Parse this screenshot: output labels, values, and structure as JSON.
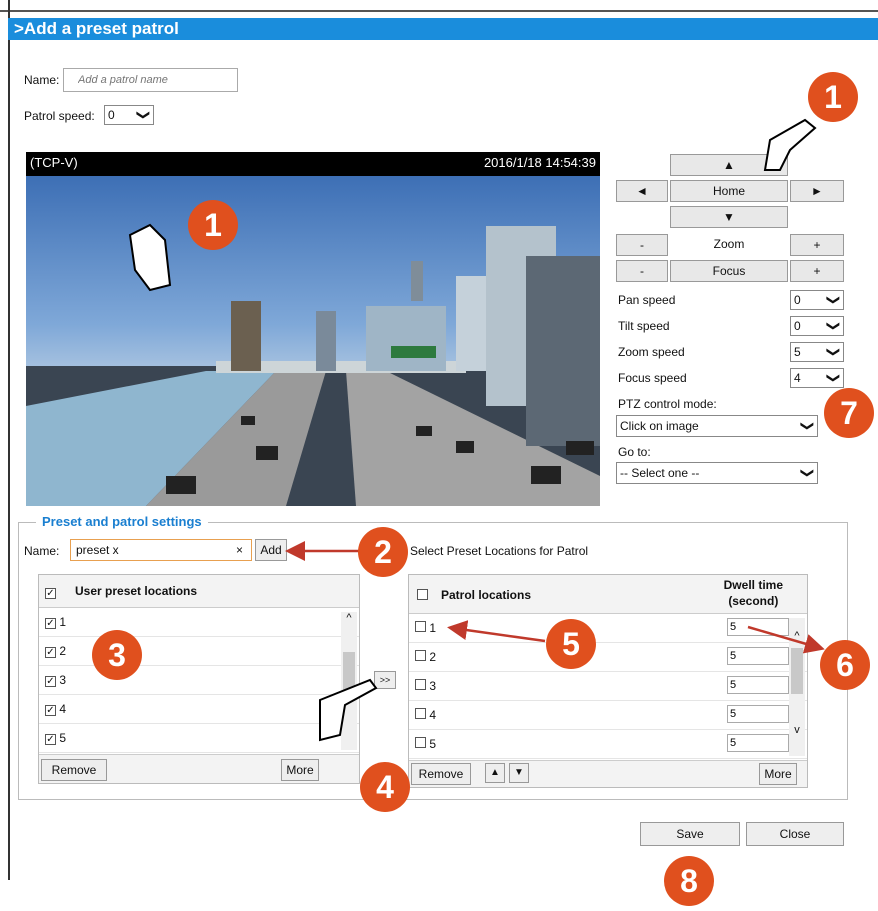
{
  "header": {
    "title": ">Add a preset patrol"
  },
  "form": {
    "name_label": "Name:",
    "name_placeholder": "Add a patrol name",
    "patrol_speed_label": "Patrol speed:",
    "patrol_speed_value": "0"
  },
  "video": {
    "source": "(TCP-V)",
    "timestamp": "2016/1/18 14:54:39"
  },
  "ptz": {
    "up": "▲",
    "left": "◄",
    "home": "Home",
    "right": "►",
    "down": "▼",
    "minus": "-",
    "plus": "+",
    "zoom": "Zoom",
    "focus": "Focus",
    "pan_speed_label": "Pan speed",
    "pan_speed": "0",
    "tilt_speed_label": "Tilt speed",
    "tilt_speed": "0",
    "zoom_speed_label": "Zoom speed",
    "zoom_speed": "5",
    "focus_speed_label": "Focus speed",
    "focus_speed": "4",
    "control_mode_label": "PTZ control mode:",
    "control_mode": "Click on image",
    "goto_label": "Go to:",
    "goto": "-- Select one --"
  },
  "settings": {
    "legend": "Preset and patrol settings",
    "name_label": "Name:",
    "name_value": "preset x",
    "clear": "×",
    "add": "Add",
    "select_hint": "Select Preset Locations for Patrol",
    "user_header": "User preset locations",
    "user_items": [
      "1",
      "2",
      "3",
      "4",
      "5"
    ],
    "remove": "Remove",
    "more": "More",
    "transfer": ">>",
    "patrol_header": "Patrol locations",
    "dwell_header_1": "Dwell time",
    "dwell_header_2": "(second)",
    "patrol_items": [
      "1",
      "2",
      "3",
      "4",
      "5"
    ],
    "dwell_values": [
      "5",
      "5",
      "5",
      "5",
      "5"
    ],
    "up_arrow": "▲",
    "down_arrow": "▼"
  },
  "footer": {
    "save": "Save",
    "close": "Close"
  },
  "callouts": {
    "c1": "1",
    "c2": "2",
    "c3": "3",
    "c4": "4",
    "c5": "5",
    "c6": "6",
    "c7": "7",
    "c8": "8"
  },
  "chevron": "❯",
  "scroll_up": "^",
  "scroll_down": "v",
  "check_mark": "✓"
}
